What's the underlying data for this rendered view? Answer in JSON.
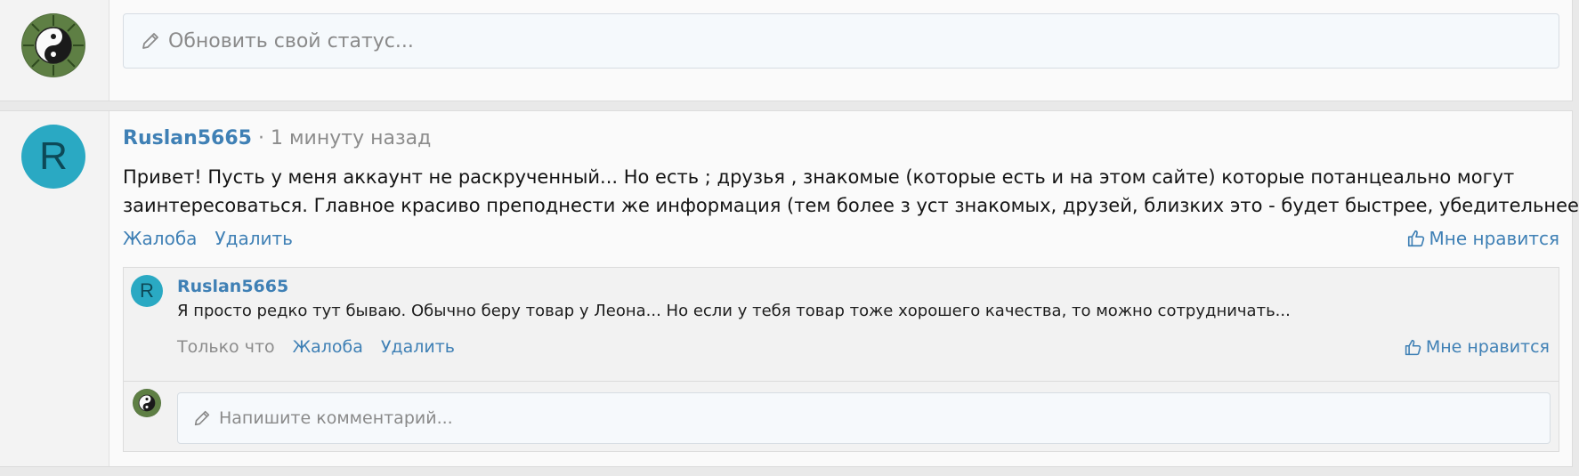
{
  "status": {
    "placeholder": "Обновить свой статус..."
  },
  "post": {
    "avatar_letter": "R",
    "author": "Ruslan5665",
    "separator": " · ",
    "time": "1 минуту назад",
    "text_line1": "Привет! Пусть у меня аккаунт не раскрученный... Но есть ; друзья , знакомые (которые есть и на этом сайте) которые потанцеально могут",
    "text_line2": "заинтересоваться. Главное красиво преподнести же информация (тем более з уст знакомых, друзей, близких это - будет быстрее, убедительнее...",
    "actions": {
      "report": "Жалоба",
      "delete": "Удалить",
      "like": "Мне нравится"
    }
  },
  "comment": {
    "avatar_letter": "R",
    "author": "Ruslan5665",
    "text": "Я просто редко тут бываю. Обычно беру товар у Леона... Но если у тебя товар тоже хорошего качества, то можно сотрудничать...",
    "time": "Только что",
    "actions": {
      "report": "Жалоба",
      "delete": "Удалить",
      "like": "Мне нравится"
    }
  },
  "comment_input": {
    "placeholder": "Напишите комментарий..."
  },
  "colors": {
    "link": "#3f80b5",
    "avatar_bg": "#2aa9c3",
    "muted": "#8c8c8c"
  },
  "icons": [
    "yin-yang-avatar-icon",
    "pencil-icon",
    "thumbs-up-icon"
  ]
}
